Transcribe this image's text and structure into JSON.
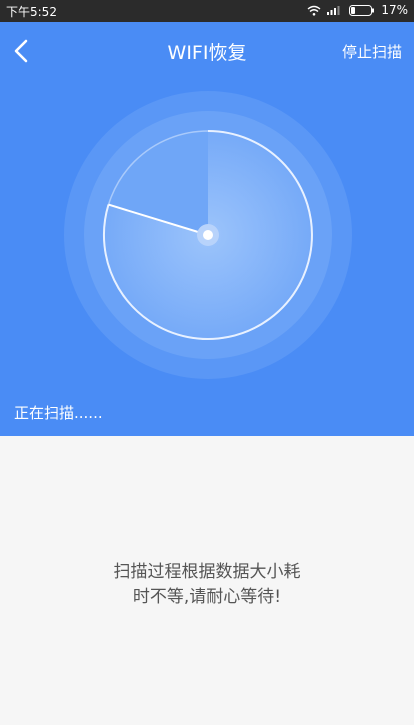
{
  "status_bar": {
    "time": "下午5:52",
    "battery_percent": "17%"
  },
  "header": {
    "title": "WIFI恢复",
    "stop_label": "停止扫描"
  },
  "scan": {
    "status_text": "正在扫描......"
  },
  "message": {
    "line1": "扫描过程根据数据大小耗",
    "line2": "时不等,请耐心等待!"
  },
  "colors": {
    "primary": "#4a8cf5",
    "background": "#f6f6f6",
    "status_bar": "#2b2b2b"
  },
  "icons": {
    "back": "chevron-left-icon",
    "wifi": "wifi-icon",
    "signal": "signal-icon",
    "battery": "battery-icon"
  }
}
